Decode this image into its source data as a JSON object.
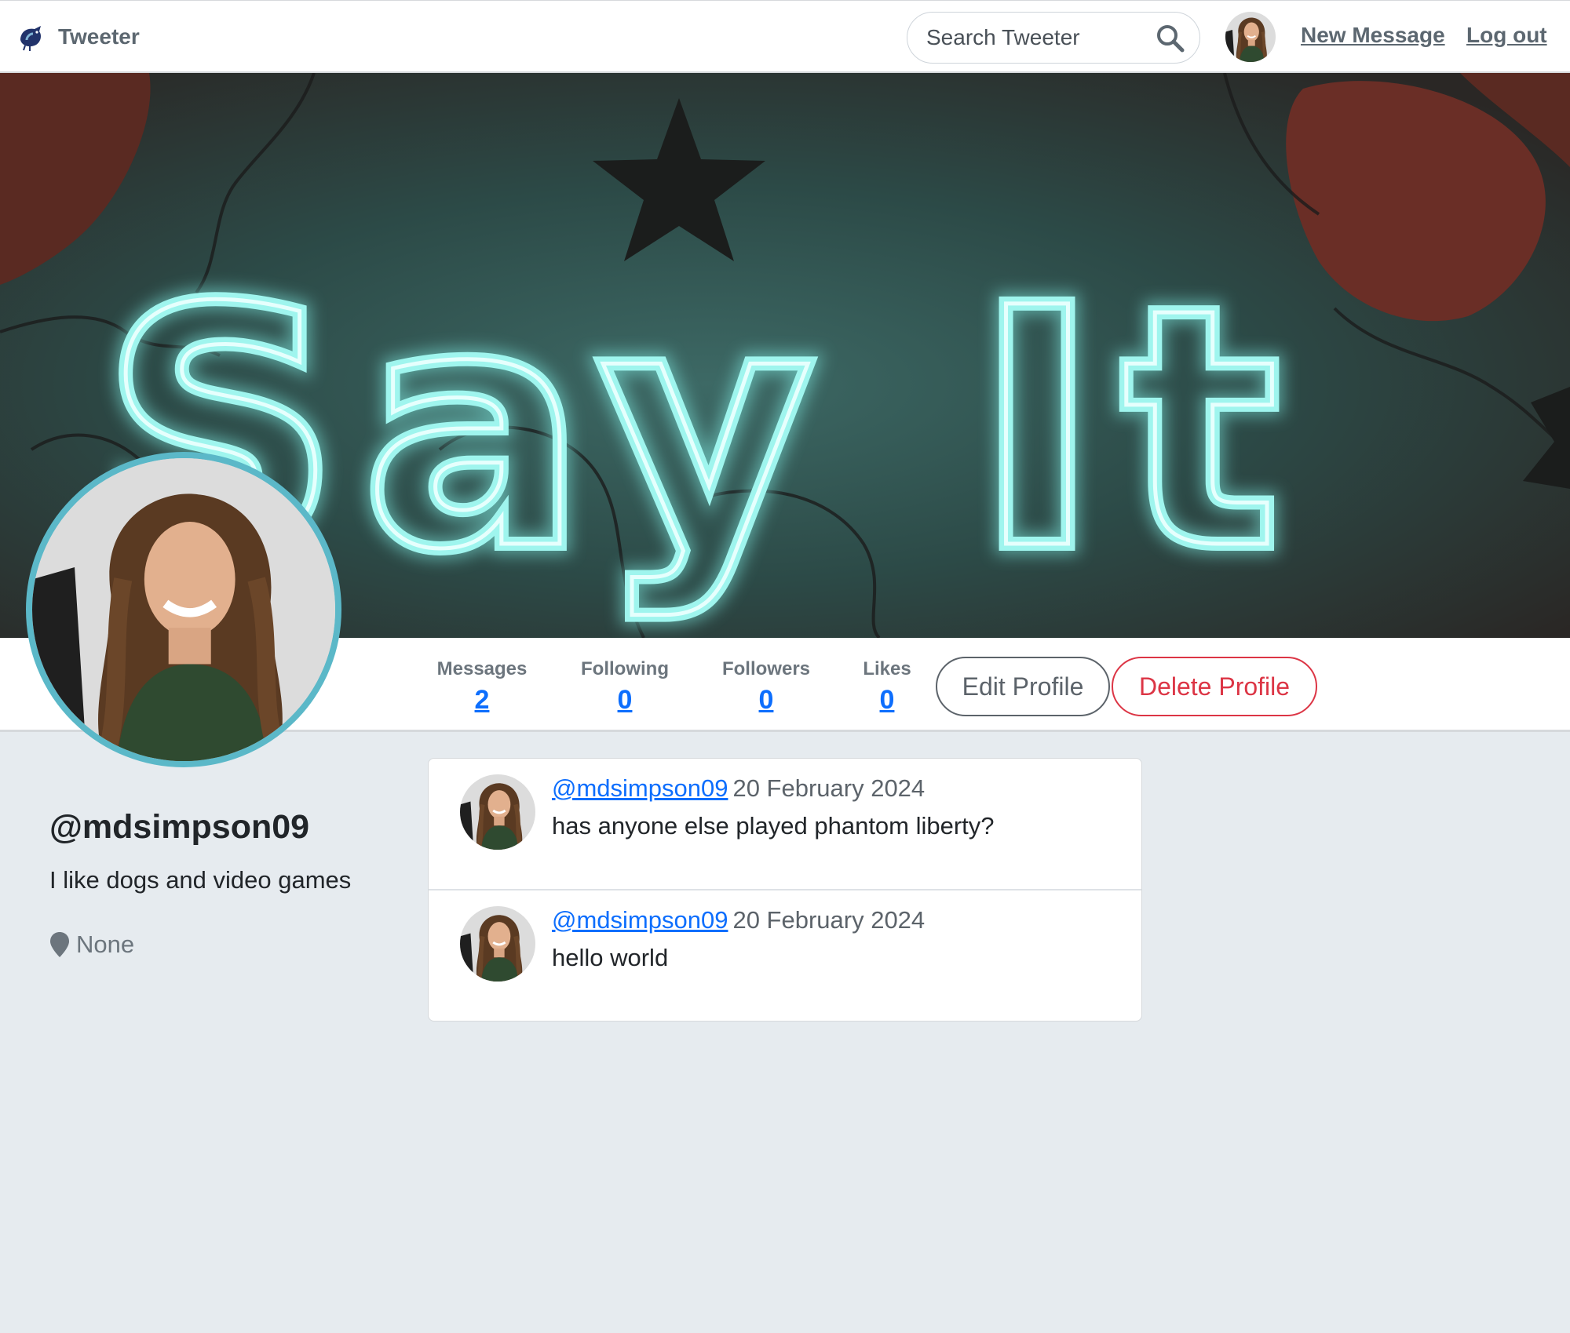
{
  "navbar": {
    "brand_name": "Tweeter",
    "search_placeholder": "Search Tweeter",
    "new_message_label": "New Message",
    "logout_label": "Log out"
  },
  "hero": {
    "neon_text": "Say It",
    "neon_color": "#7fe9e0"
  },
  "stats": [
    {
      "label": "Messages",
      "value": "2"
    },
    {
      "label": "Following",
      "value": "0"
    },
    {
      "label": "Followers",
      "value": "0"
    },
    {
      "label": "Likes",
      "value": "0"
    }
  ],
  "actions": {
    "edit_label": "Edit Profile",
    "delete_label": "Delete Profile"
  },
  "profile": {
    "username": "@mdsimpson09",
    "bio": "I like dogs and video games",
    "location": "None"
  },
  "messages": [
    {
      "user": "@mdsimpson09",
      "date": "20 February 2024",
      "text": "has anyone else played phantom liberty?"
    },
    {
      "user": "@mdsimpson09",
      "date": "20 February 2024",
      "text": "hello world"
    }
  ],
  "colors": {
    "link_blue": "#0d6efd",
    "danger_red": "#dc3545",
    "avatar_ring": "#5bb8c8",
    "page_background": "#e6ebef"
  }
}
